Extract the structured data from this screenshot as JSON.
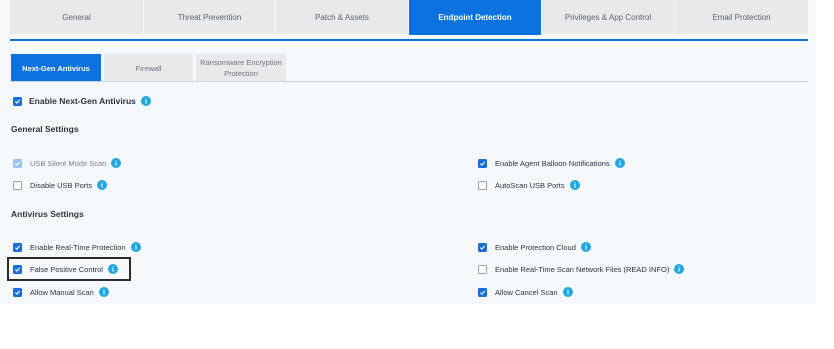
{
  "top_tabs": [
    {
      "label": "General",
      "active": false
    },
    {
      "label": "Threat Prevention",
      "active": false
    },
    {
      "label": "Patch & Assets",
      "active": false
    },
    {
      "label": "Endpoint Detection",
      "active": true
    },
    {
      "label": "Privileges & App Control",
      "active": false
    },
    {
      "label": "Email Protection",
      "active": false
    }
  ],
  "sub_tabs": [
    {
      "label": "Next-Gen Antivirus",
      "active": true
    },
    {
      "label": "Firewall",
      "active": false
    },
    {
      "label": "Ransomware Encryption Protection",
      "active": false
    }
  ],
  "enable_ngav": {
    "label": "Enable Next-Gen Antivirus",
    "checked": true
  },
  "general_settings": {
    "heading": "General Settings",
    "usb_silent": {
      "label": "USB Silent Mode Scan",
      "checked": true,
      "disabled": true
    },
    "disable_usb": {
      "label": "Disable USB Ports",
      "checked": false
    },
    "agent_balloon": {
      "label": "Enable Agent Balloon Notifications",
      "checked": true
    },
    "autoscan_usb": {
      "label": "AutoScan USB Ports",
      "checked": false
    }
  },
  "antivirus_settings": {
    "heading": "Antivirus Settings",
    "realtime": {
      "label": "Enable Real-Time Protection",
      "checked": true
    },
    "false_positive": {
      "label": "False Positive Control",
      "checked": true
    },
    "manual_scan": {
      "label": "Allow Manual Scan",
      "checked": true
    },
    "protection_cloud": {
      "label": "Enable Protection Cloud",
      "checked": true
    },
    "network_files": {
      "label": "Enable Real-Time Scan Network Files (READ INFO)",
      "checked": false
    },
    "cancel_scan": {
      "label": "Allow Cancel Scan",
      "checked": true
    }
  },
  "colors": {
    "accent": "#0b72e0",
    "info": "#22a7e0",
    "tab_inactive": "#e8e9eb"
  },
  "icons": {
    "check": "check-icon",
    "info": "info-icon"
  }
}
